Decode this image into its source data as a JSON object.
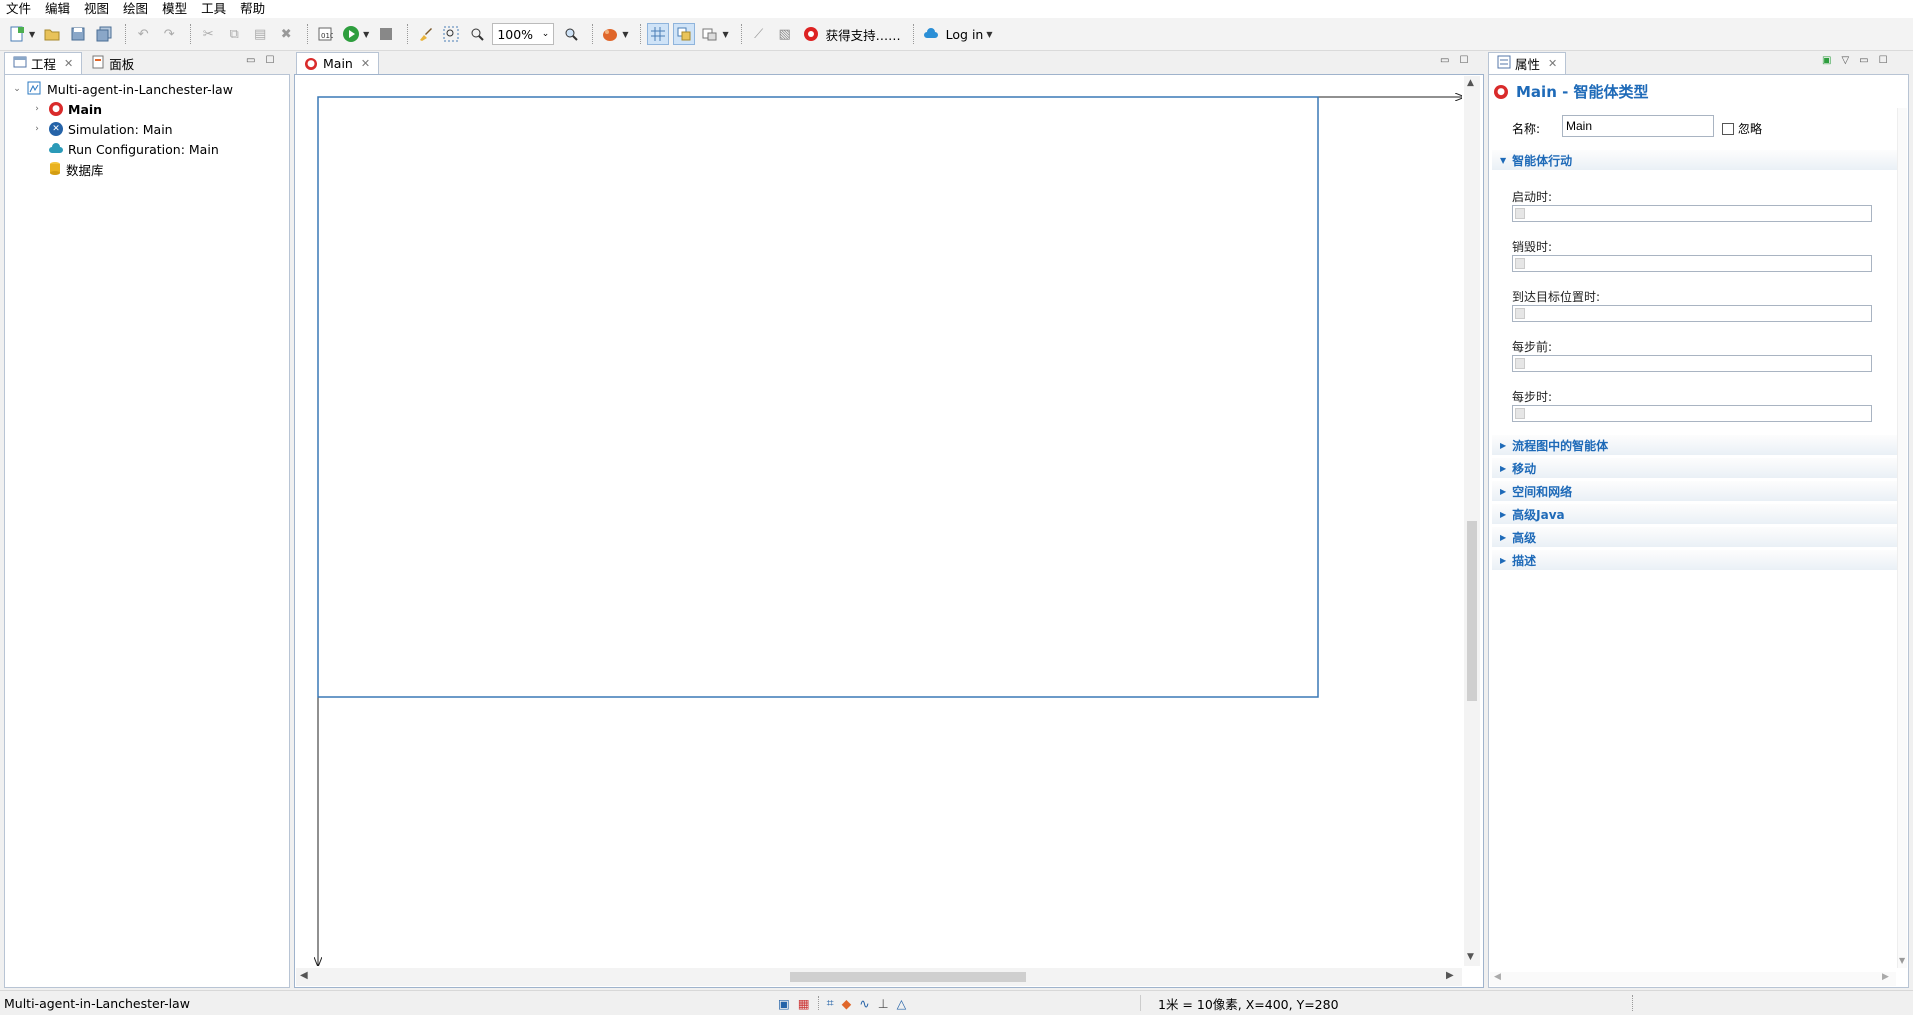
{
  "menubar": {
    "items": [
      "文件",
      "编辑",
      "视图",
      "绘图",
      "模型",
      "工具",
      "帮助"
    ]
  },
  "toolbar": {
    "zoom_value": "100%",
    "support_label": "获得支持……",
    "login_label": "Log in"
  },
  "left_panel": {
    "tabs": [
      "工程",
      "面板"
    ],
    "tree": {
      "root": "Multi-agent-in-Lanchester-law",
      "items": [
        "Main",
        "Simulation: Main",
        "Run Configuration: Main",
        "数据库"
      ]
    }
  },
  "editor": {
    "tab_label": "Main"
  },
  "properties": {
    "tab_label": "属性",
    "title": "Main - 智能体类型",
    "name_label": "名称:",
    "name_value": "Main",
    "ignore_label": "忽略",
    "agent_actions": {
      "header": "智能体行动",
      "fields": [
        "启动时:",
        "销毁时:",
        "到达目标位置时:",
        "每步前:",
        "每步时:"
      ]
    },
    "collapsed_sections": [
      "流程图中的智能体",
      "移动",
      "空间和网络",
      "高级Java",
      "高级",
      "描述"
    ]
  },
  "statusbar": {
    "left_text": "Multi-agent-in-Lanchester-law",
    "scale_text": "1米 = 10像素, X=400, Y=280"
  },
  "colors": {
    "accent": "#1e6ab8",
    "frame": "#3a78b5",
    "main_icon": "#d92b2b"
  }
}
